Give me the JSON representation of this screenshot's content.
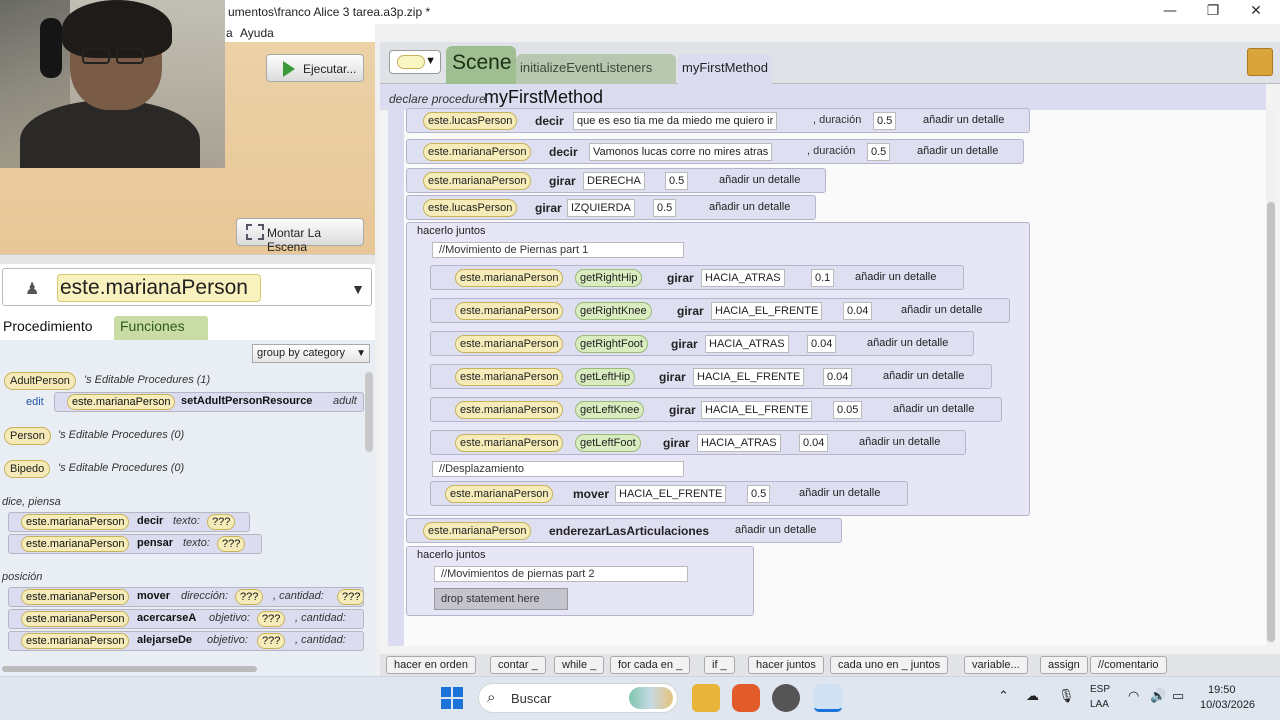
{
  "window": {
    "title": "umentos\\franco Alice 3 tarea.a3p.zip *",
    "menu": [
      "a",
      "Ayuda"
    ],
    "controls": {
      "minimize": "—",
      "restore": "❐",
      "close": "✕"
    }
  },
  "scene_panel": {
    "run_button": "Ejecutar...",
    "setup_button": "Montar La Escena"
  },
  "left_panel": {
    "selected_object": "este.marianaPerson",
    "tab_procedures": "Procedimiento",
    "tab_functions": "Funciones",
    "group_by": "group by category",
    "sections": {
      "adult": {
        "type": "AdultPerson",
        "label": "'s Editable Procedures (1)"
      },
      "person": {
        "type": "Person",
        "label": "'s Editable Procedures (0)"
      },
      "biped": {
        "type": "Bipedo",
        "label": "'s Editable Procedures (0)"
      }
    },
    "edit_link": "edit",
    "adult_proc": {
      "target": "este.marianaPerson",
      "name": "setAdultPersonResource",
      "param": "adult"
    },
    "cat_say": "dice, piensa",
    "say": {
      "target": "este.marianaPerson",
      "name": "decir",
      "param": "texto:",
      "value": "???"
    },
    "think": {
      "target": "este.marianaPerson",
      "name": "pensar",
      "param": "texto:",
      "value": "???"
    },
    "cat_pos": "posición",
    "move": {
      "target": "este.marianaPerson",
      "name": "mover",
      "p1": "dirección:",
      "v1": "???",
      "p2": ", cantidad:",
      "v2": "???"
    },
    "approach": {
      "target": "este.marianaPerson",
      "name": "acercarseA",
      "p1": "objetivo:",
      "v1": "???",
      "p2": ", cantidad:"
    },
    "away": {
      "target": "este.marianaPerson",
      "name": "alejarseDe",
      "p1": "objetivo:",
      "v1": "???",
      "p2": ", cantidad:"
    }
  },
  "editor": {
    "tab_scene": "Scene",
    "tab_listeners": "initializeEventListeners",
    "tab_method": "myFirstMethod",
    "declare_label": "declare procedure",
    "method_name": "myFirstMethod",
    "add_detail": "añadir un detalle",
    "lines": [
      {
        "target": "este.lucasPerson",
        "verb": "decir",
        "arg": "que es eso tia me da miedo me quiero ir",
        "dur_label": ", duración",
        "dur": "0.5"
      },
      {
        "target": "este.marianaPerson",
        "verb": "decir",
        "arg": "Vamonos lucas corre no mires atras",
        "dur_label": ", duración",
        "dur": "0.5"
      },
      {
        "target": "este.marianaPerson",
        "verb": "girar",
        "arg": "DERECHA",
        "dur": "0.5"
      },
      {
        "target": "este.lucasPerson",
        "verb": "girar",
        "arg": "IZQUIERDA",
        "dur": "0.5"
      }
    ],
    "together1": {
      "label": "hacerlo juntos",
      "comment": "//Movimiento de Piernas part 1",
      "joints": [
        {
          "target": "este.marianaPerson",
          "joint": "getRightHip",
          "verb": "girar",
          "dir": "HACIA_ATRAS",
          "amt": "0.1"
        },
        {
          "target": "este.marianaPerson",
          "joint": "getRightKnee",
          "verb": "girar",
          "dir": "HACIA_EL_FRENTE",
          "amt": "0.04"
        },
        {
          "target": "este.marianaPerson",
          "joint": "getRightFoot",
          "verb": "girar",
          "dir": "HACIA_ATRAS",
          "amt": "0.04"
        },
        {
          "target": "este.marianaPerson",
          "joint": "getLeftHip",
          "verb": "girar",
          "dir": "HACIA_EL_FRENTE",
          "amt": "0.04"
        },
        {
          "target": "este.marianaPerson",
          "joint": "getLeftKnee",
          "verb": "girar",
          "dir": "HACIA_EL_FRENTE",
          "amt": "0.05"
        },
        {
          "target": "este.marianaPerson",
          "joint": "getLeftFoot",
          "verb": "girar",
          "dir": "HACIA_ATRAS",
          "amt": "0.04"
        }
      ],
      "comment2": "//Desplazamiento",
      "move": {
        "target": "este.marianaPerson",
        "verb": "mover",
        "dir": "HACIA_EL_FRENTE",
        "amt": "0.5"
      }
    },
    "straighten": {
      "target": "este.marianaPerson",
      "verb": "enderezarLasArticulaciones"
    },
    "together2": {
      "label": "hacerlo juntos",
      "comment": "//Movimientos de piernas part 2",
      "drop": "drop statement here"
    }
  },
  "palette": [
    "hacer en orden",
    "contar _",
    "while _",
    "for cada en _",
    "if _",
    "hacer juntos",
    "cada uno en _ juntos",
    "variable...",
    "assign",
    "//comentario"
  ],
  "taskbar": {
    "search": "Buscar",
    "lang": "ESP",
    "lang2": "LAA",
    "time": "19:50",
    "date": "10/03/2026"
  }
}
